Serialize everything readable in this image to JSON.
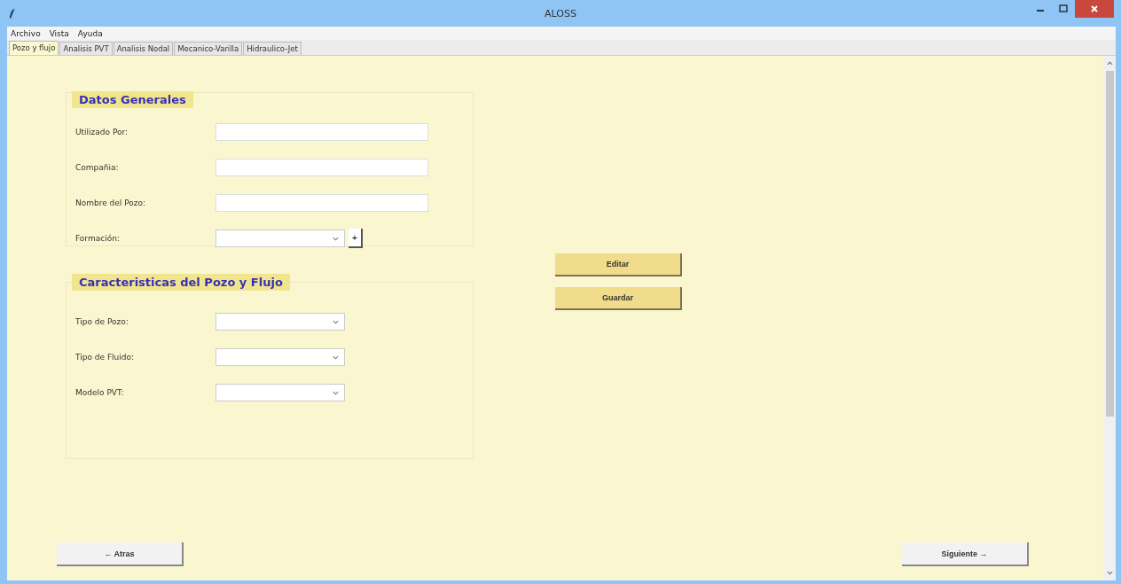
{
  "window": {
    "title": "ALOSS"
  },
  "menu": [
    "Archivo",
    "Vista",
    "Ayuda"
  ],
  "tabs": [
    {
      "label": "Pozo y flujo",
      "selected": true
    },
    {
      "label": "Analisis PVT",
      "selected": false
    },
    {
      "label": "Analisis Nodal",
      "selected": false
    },
    {
      "label": "Mecanico-Varilla",
      "selected": false
    },
    {
      "label": "Hidraulico-Jet",
      "selected": false
    }
  ],
  "groups": [
    {
      "title": "Datos Generales",
      "fields": [
        {
          "label": "Utilizado Por:",
          "kind": "text"
        },
        {
          "label": "Compañia:",
          "kind": "text"
        },
        {
          "label": "Nombre del Pozo:",
          "kind": "text"
        },
        {
          "label": "Formación:",
          "kind": "combo",
          "add_button": "+"
        }
      ]
    },
    {
      "title": "Caracteristicas del Pozo y Flujo",
      "fields": [
        {
          "label": "Tipo de Pozo:",
          "kind": "combo"
        },
        {
          "label": "Tipo de Fluido:",
          "kind": "combo"
        },
        {
          "label": "Modelo PVT:",
          "kind": "combo"
        }
      ]
    }
  ],
  "actions": [
    "Editar",
    "Guardar"
  ],
  "nav": {
    "back": "← Atras",
    "next": "Siguiente →"
  }
}
